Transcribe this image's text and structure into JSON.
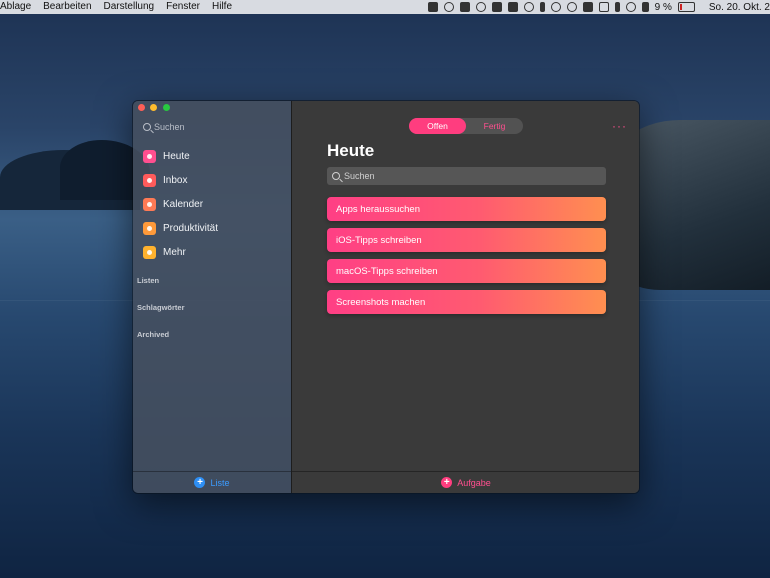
{
  "menubar": {
    "items": [
      "Ablage",
      "Bearbeiten",
      "Darstellung",
      "Fenster",
      "Hilfe"
    ],
    "battery": "9 %",
    "clock": "So. 20. Okt. 2",
    "tray_icons": [
      "grid-icon",
      "eye-icon",
      "shield-icon",
      "checkmark-circle-icon",
      "cube-icon",
      "a-icon",
      "info-icon",
      "bolt-icon",
      "dropbox-icon",
      "time-machine-icon",
      "mail-icon",
      "airplay-icon",
      "bluetooth-icon",
      "wifi-icon",
      "volume-icon"
    ]
  },
  "sidebar": {
    "search_placeholder": "Suchen",
    "items": [
      {
        "label": "Heute",
        "color": "#ff4f8f"
      },
      {
        "label": "Inbox",
        "color": "#ff5b5b"
      },
      {
        "label": "Kalender",
        "color": "#ff7a55"
      },
      {
        "label": "Produktivität",
        "color": "#ff9a3a"
      },
      {
        "label": "Mehr",
        "color": "#ffb22e"
      }
    ],
    "sections": [
      "Listen",
      "Schlagwörter",
      "Archived"
    ],
    "add_list_label": "Liste"
  },
  "main": {
    "segments": [
      "Offen",
      "Fertig"
    ],
    "selected_segment": "Offen",
    "title": "Heute",
    "search_placeholder": "Suchen",
    "tasks": [
      "Apps heraussuchen",
      "iOS-Tipps schreiben",
      "macOS-Tipps schreiben",
      "Screenshots machen"
    ],
    "add_task_label": "Aufgabe",
    "more_label": "···"
  },
  "colors": {
    "accent": "#ff3d7f",
    "blue_accent": "#2e8ff5"
  }
}
